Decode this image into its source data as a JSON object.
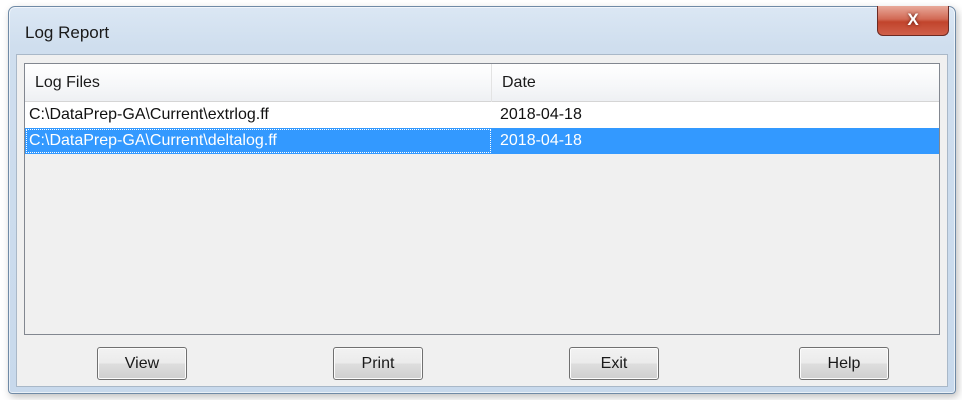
{
  "window": {
    "title": "Log Report",
    "close_label": "X"
  },
  "listview": {
    "columns": [
      "Log Files",
      "Date"
    ],
    "rows": [
      {
        "file": "C:\\DataPrep-GA\\Current\\extrlog.ff",
        "date": "2018-04-18",
        "selected": false
      },
      {
        "file": "C:\\DataPrep-GA\\Current\\deltalog.ff",
        "date": "2018-04-18",
        "selected": true
      }
    ]
  },
  "buttons": {
    "view_label": "View",
    "print_label": "Print",
    "exit_label": "Exit",
    "help_label": "Help"
  },
  "colors": {
    "selection": "#3399ff",
    "close_button": "#c1442c"
  },
  "icons": {
    "close": "close-icon"
  }
}
